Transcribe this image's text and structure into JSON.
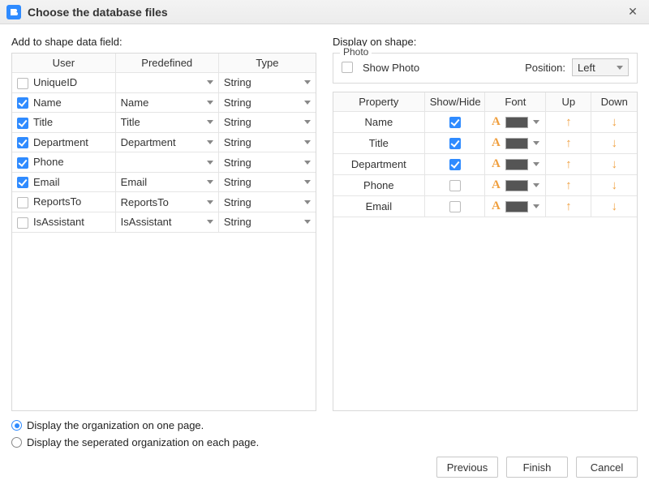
{
  "window": {
    "title": "Choose the database files"
  },
  "left": {
    "title": "Add to shape data field:",
    "headers": {
      "user": "User",
      "predefined": "Predefined",
      "type": "Type"
    },
    "rows": [
      {
        "user": "UniqueID",
        "checked": false,
        "predefined": "",
        "type": "String"
      },
      {
        "user": "Name",
        "checked": true,
        "predefined": "Name",
        "type": "String"
      },
      {
        "user": "Title",
        "checked": true,
        "predefined": "Title",
        "type": "String"
      },
      {
        "user": "Department",
        "checked": true,
        "predefined": "Department",
        "type": "String"
      },
      {
        "user": "Phone",
        "checked": true,
        "predefined": "",
        "type": "String"
      },
      {
        "user": "Email",
        "checked": true,
        "predefined": "Email",
        "type": "String"
      },
      {
        "user": "ReportsTo",
        "checked": false,
        "predefined": "ReportsTo",
        "type": "String"
      },
      {
        "user": "IsAssistant",
        "checked": false,
        "predefined": "IsAssistant",
        "type": "String"
      }
    ]
  },
  "right": {
    "title": "Display on shape:",
    "photo": {
      "legend": "Photo",
      "show_label": "Show Photo",
      "show_checked": false,
      "position_label": "Position:",
      "position_value": "Left"
    },
    "headers": {
      "property": "Property",
      "showhide": "Show/Hide",
      "font": "Font",
      "up": "Up",
      "down": "Down"
    },
    "rows": [
      {
        "property": "Name",
        "show": true
      },
      {
        "property": "Title",
        "show": true
      },
      {
        "property": "Department",
        "show": true
      },
      {
        "property": "Phone",
        "show": false
      },
      {
        "property": "Email",
        "show": false
      }
    ]
  },
  "options": {
    "one_page": "Display the organization on one page.",
    "each_page": "Display the seperated organization on each page.",
    "selected": "one_page"
  },
  "buttons": {
    "previous": "Previous",
    "finish": "Finish",
    "cancel": "Cancel"
  }
}
